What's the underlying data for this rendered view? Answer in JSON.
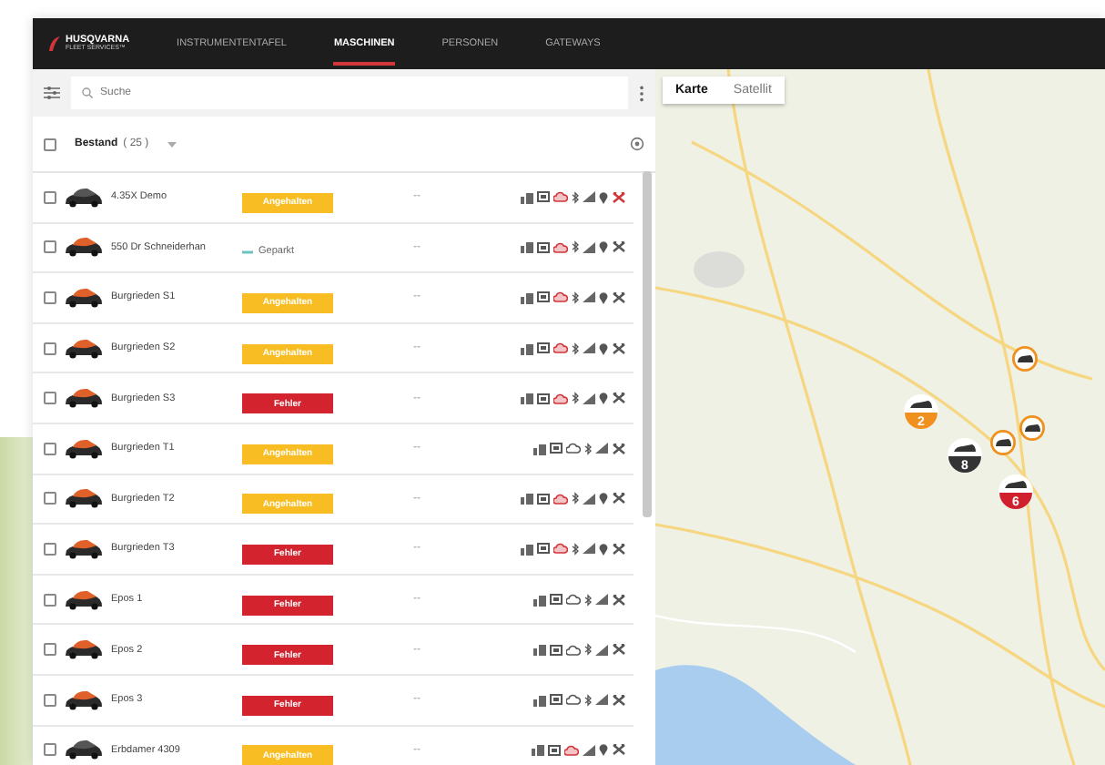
{
  "header": {
    "logo": "HUSQVARNA",
    "logo_sub": "FLEET SERVICES™",
    "nav": [
      {
        "label": "INSTRUMENTENTAFEL",
        "selected": false
      },
      {
        "label": "MASCHINEN",
        "selected": true
      },
      {
        "label": "PERSONEN",
        "selected": false
      },
      {
        "label": "GATEWAYS",
        "selected": false
      }
    ]
  },
  "search": {
    "placeholder": "Suche"
  },
  "group": {
    "label": "Bestand",
    "count": "( 25 )",
    "checked": false
  },
  "rows": [
    {
      "name": "4.35X Demo",
      "status": "Angehalten",
      "kind": "warning",
      "extra": "--",
      "checked": false,
      "color": "#555555",
      "pin": true,
      "bluetooth": true,
      "cloud_error": true,
      "tool_error": true
    },
    {
      "name": "550 Dr Schneiderhan",
      "status": "Geparkt",
      "kind": "parked",
      "extra": "--",
      "checked": false,
      "color": "#e0602a",
      "pin": true,
      "bluetooth": true,
      "cloud_error": true,
      "tool_error": false
    },
    {
      "name": "Burgrieden S1",
      "status": "Angehalten",
      "kind": "warning",
      "extra": "--",
      "checked": false,
      "color": "#e0602a",
      "pin": true,
      "bluetooth": true,
      "cloud_error": true,
      "tool_error": false
    },
    {
      "name": "Burgrieden S2",
      "status": "Angehalten",
      "kind": "warning",
      "extra": "--",
      "checked": false,
      "color": "#e0602a",
      "pin": true,
      "bluetooth": true,
      "cloud_error": true,
      "tool_error": false
    },
    {
      "name": "Burgrieden S3",
      "status": "Fehler",
      "kind": "error",
      "extra": "--",
      "checked": false,
      "color": "#e0602a",
      "pin": true,
      "bluetooth": true,
      "cloud_error": true,
      "tool_error": false
    },
    {
      "name": "Burgrieden T1",
      "status": "Angehalten",
      "kind": "warning",
      "extra": "--",
      "checked": false,
      "color": "#e0602a",
      "pin": false,
      "bluetooth": true,
      "cloud_error": false,
      "tool_error": false
    },
    {
      "name": "Burgrieden T2",
      "status": "Angehalten",
      "kind": "warning",
      "extra": "--",
      "checked": false,
      "color": "#e0602a",
      "pin": true,
      "bluetooth": true,
      "cloud_error": true,
      "tool_error": false
    },
    {
      "name": "Burgrieden T3",
      "status": "Fehler",
      "kind": "error",
      "extra": "--",
      "checked": false,
      "color": "#e0602a",
      "pin": true,
      "bluetooth": true,
      "cloud_error": true,
      "tool_error": false
    },
    {
      "name": "Epos 1",
      "status": "Fehler",
      "kind": "error",
      "extra": "--",
      "checked": false,
      "color": "#e0602a",
      "pin": false,
      "bluetooth": true,
      "cloud_error": false,
      "tool_error": false
    },
    {
      "name": "Epos 2",
      "status": "Fehler",
      "kind": "error",
      "extra": "--",
      "checked": false,
      "color": "#e0602a",
      "pin": false,
      "bluetooth": true,
      "cloud_error": false,
      "tool_error": false
    },
    {
      "name": "Epos 3",
      "status": "Fehler",
      "kind": "error",
      "extra": "--",
      "checked": false,
      "color": "#e0602a",
      "pin": false,
      "bluetooth": true,
      "cloud_error": false,
      "tool_error": false
    },
    {
      "name": "Erbdamer 4309",
      "status": "Angehalten",
      "kind": "warning",
      "extra": "--",
      "checked": false,
      "color": "#555555",
      "pin": true,
      "bluetooth": false,
      "cloud_error": true,
      "tool_error": false
    }
  ],
  "map": {
    "tabs": [
      {
        "label": "Karte",
        "selected": true
      },
      {
        "label": "Satellit",
        "selected": false
      }
    ],
    "markers": [
      {
        "kind": "cluster",
        "count": "2",
        "color": "#f0901e"
      },
      {
        "kind": "cluster",
        "count": "8",
        "color": "#333333"
      },
      {
        "kind": "cluster",
        "count": "6",
        "color": "#d0202e"
      },
      {
        "kind": "single",
        "color": "#f0901e"
      },
      {
        "kind": "single",
        "color": "#f0901e"
      },
      {
        "kind": "single",
        "color": "#f0901e"
      }
    ]
  }
}
